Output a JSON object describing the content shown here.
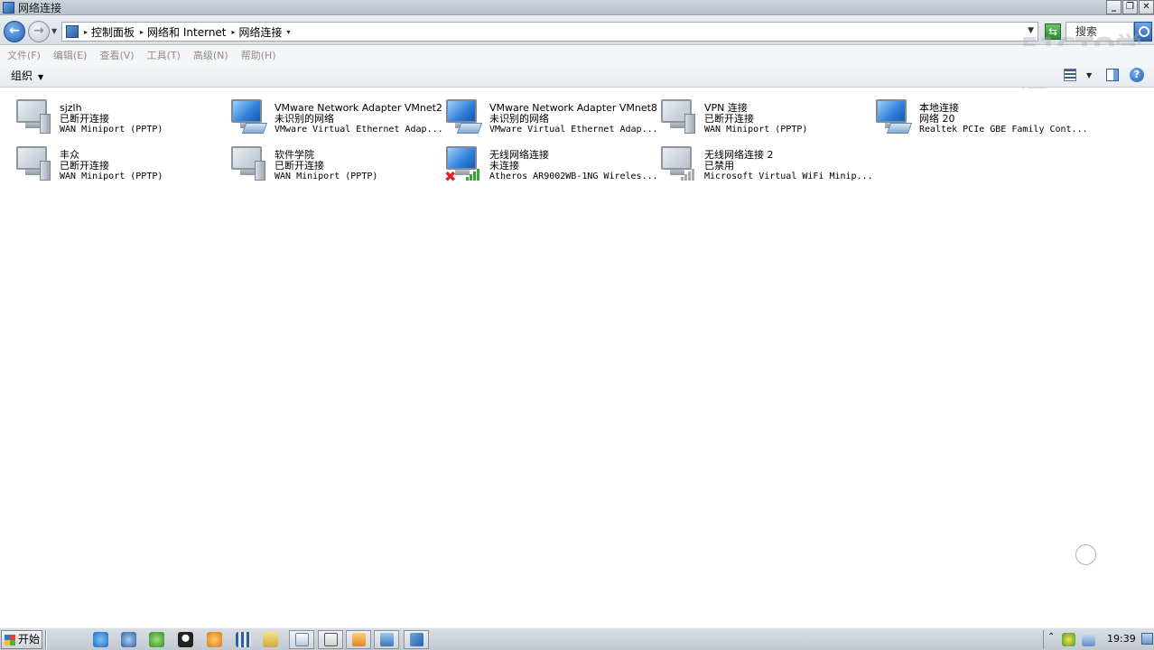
{
  "window": {
    "title": "网络连接",
    "controls": [
      "minimize",
      "restore",
      "close"
    ]
  },
  "address": {
    "breadcrumbs": [
      "控制面板",
      "网络和 Internet",
      "网络连接"
    ],
    "search_placeholder": "搜索"
  },
  "watermark": "51CTO学院",
  "menu": {
    "items": [
      "文件(F)",
      "编辑(E)",
      "查看(V)",
      "工具(T)",
      "高级(N)",
      "帮助(H)"
    ]
  },
  "command_bar": {
    "organize": "组织"
  },
  "connections": [
    {
      "name": "sjzlh",
      "status": "已断开连接",
      "device": "WAN Miniport (PPTP)",
      "icon": "dialup-computer-icon"
    },
    {
      "name": "VMware Network Adapter VMnet2",
      "status": "未识别的网络",
      "device": "VMware Virtual Ethernet Adap...",
      "icon": "network-adapter-icon"
    },
    {
      "name": "VMware Network Adapter VMnet8",
      "status": "未识别的网络",
      "device": "VMware Virtual Ethernet Adap...",
      "icon": "network-adapter-icon"
    },
    {
      "name": "VPN 连接",
      "status": "已断开连接",
      "device": "WAN Miniport (PPTP)",
      "icon": "dialup-computer-icon"
    },
    {
      "name": "本地连接",
      "status": "网络  20",
      "device": "Realtek PCIe GBE Family Cont...",
      "icon": "network-adapter-icon"
    },
    {
      "name": "丰众",
      "status": "已断开连接",
      "device": "WAN Miniport (PPTP)",
      "icon": "dialup-computer-icon"
    },
    {
      "name": "软件学院",
      "status": "已断开连接",
      "device": "WAN Miniport (PPTP)",
      "icon": "dialup-computer-icon"
    },
    {
      "name": "无线网络连接",
      "status": "未连接",
      "device": "Atheros AR9002WB-1NG Wireles...",
      "icon": "wireless-disconnected-icon"
    },
    {
      "name": "无线网络连接 2",
      "status": "已禁用",
      "device": "Microsoft Virtual WiFi Minip...",
      "icon": "wireless-disabled-icon"
    }
  ],
  "taskbar": {
    "start": "开始",
    "clock": "19:39",
    "tray_chevron": "⌃"
  },
  "colors": {
    "titlebar": "#c4cbd3",
    "address_back": "#1c5db3",
    "signal_green": "#3aa43a",
    "error_red": "#e12525"
  }
}
